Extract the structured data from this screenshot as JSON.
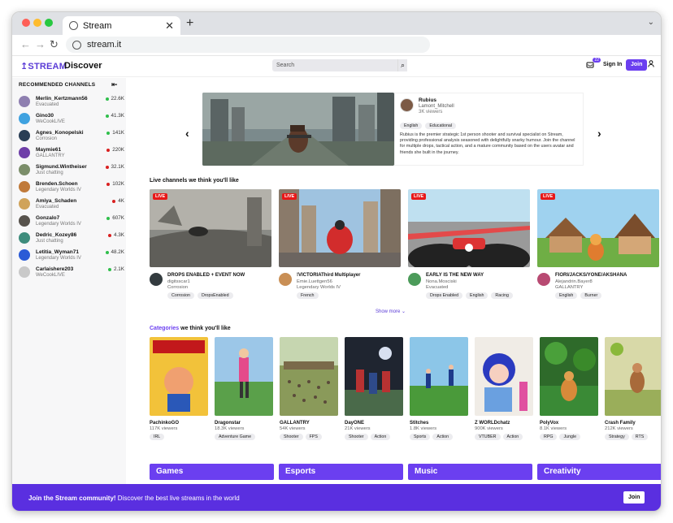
{
  "browser": {
    "tab_title": "Stream",
    "url": "stream.it"
  },
  "header": {
    "logo": "STREAM",
    "page_title": "Discover",
    "search_placeholder": "Search",
    "notif_count": "22",
    "signin_label": "Sign In",
    "join_label": "Join"
  },
  "sidebar": {
    "title": "RECOMMENDED CHANNELS",
    "channels": [
      {
        "name": "Merlin_Kertzmann56",
        "game": "Evacuated",
        "viewers": "22.6K",
        "status": "#2fbf4b",
        "avatar": "#8e7fb0"
      },
      {
        "name": "Gino30",
        "game": "WeCookLIVE",
        "viewers": "41.3K",
        "status": "#2fbf4b",
        "avatar": "#3fa2e0"
      },
      {
        "name": "Agnes_Konopelski",
        "game": "Corrosion",
        "viewers": "141K",
        "status": "#2fbf4b",
        "avatar": "#2a3e55"
      },
      {
        "name": "Maymie61",
        "game": "GALLANTRY",
        "viewers": "220K",
        "status": "#d92020",
        "avatar": "#6e3fa8"
      },
      {
        "name": "Sigmund.Wintheiser",
        "game": "Just chatting",
        "viewers": "32.1K",
        "status": "#d92020",
        "avatar": "#7b8e6a"
      },
      {
        "name": "Brenden.Schoen",
        "game": "Legendary Worlds IV",
        "viewers": "102K",
        "status": "#d92020",
        "avatar": "#c07a3a"
      },
      {
        "name": "Amiya_Schaden",
        "game": "Evacuated",
        "viewers": "4K",
        "status": "#d92020",
        "avatar": "#d0a35a"
      },
      {
        "name": "Gonzalo7",
        "game": "Legendary Worlds IV",
        "viewers": "607K",
        "status": "#2fbf4b",
        "avatar": "#57524c"
      },
      {
        "name": "Dedric_Kozey86",
        "game": "Just chatting",
        "viewers": "4.3K",
        "status": "#d92020",
        "avatar": "#3e8c7c"
      },
      {
        "name": "Letitia_Wyman71",
        "game": "Legendary Worlds IV",
        "viewers": "48.2K",
        "status": "#2fbf4b",
        "avatar": "#2b5bd6"
      },
      {
        "name": "Carlaishere203",
        "game": "WeCookLIVE",
        "viewers": "2.1K",
        "status": "#2fbf4b",
        "avatar": "#c9c9c9"
      }
    ]
  },
  "featured": {
    "name": "Rubius",
    "user": "Lamont_Mitchell",
    "viewers": "3K viewers",
    "tags": [
      "English",
      "Educational"
    ],
    "description": "Rubius is the premier strategic 1st person shooter and survival specialist on Stream, providing professional analysis seasoned with delightfully snarky humour. Join the channel for multiple drops, tactical action, and a mature community based on the users avatar and friends she built in the journey."
  },
  "live_section": {
    "title": "Live channels we think you'll like",
    "live_badge": "LIVE",
    "show_more": "Show more",
    "channels": [
      {
        "title": "DROPS ENABLED + EVENT NOW",
        "user": "digitsscar1",
        "game": "Corrosion",
        "tags": [
          "Corrosion",
          "DropsEnabled"
        ],
        "avatar": "#333b3f"
      },
      {
        "title": "!VICTORIAThird Multiplayer",
        "user": "Emie.Luettgen56",
        "game": "Legendary Worlds IV",
        "tags": [
          "French"
        ],
        "avatar": "#c98f55"
      },
      {
        "title": "EARLY IS THE NEW WAY",
        "user": "Nona.Mosciski",
        "game": "Evacuated",
        "tags": [
          "Drops Enabled",
          "English",
          "Racing"
        ],
        "avatar": "#4c9b5a"
      },
      {
        "title": "FIORI/JACKS/YONE/AKSHANA",
        "user": "Alejandrin.Bayer8",
        "game": "GALLANTRY",
        "tags": [
          "English",
          "Burner"
        ],
        "avatar": "#b84a72"
      }
    ]
  },
  "categories_section": {
    "title_accent": "Categories",
    "title_rest": " we think you'll like",
    "items": [
      {
        "name": "PachinkoGO",
        "viewers": "117K viewers",
        "tags": [
          "IRL"
        ]
      },
      {
        "name": "Dragonstar",
        "viewers": "18.3K viewers",
        "tags": [
          "Adventure Game"
        ]
      },
      {
        "name": "GALLANTRY",
        "viewers": "54K viewers",
        "tags": [
          "Shooter",
          "FPS"
        ]
      },
      {
        "name": "DayONE",
        "viewers": "21K viewers",
        "tags": [
          "Shooter",
          "Action"
        ]
      },
      {
        "name": "Stitches",
        "viewers": "1.8K viewers",
        "tags": [
          "Sports",
          "Action"
        ]
      },
      {
        "name": "Z WORLDchatz",
        "viewers": "900K viewers",
        "tags": [
          "VTUBER",
          "Action"
        ]
      },
      {
        "name": "PolyVox",
        "viewers": "8.1K viewers",
        "tags": [
          "RPG",
          "Jungle"
        ]
      },
      {
        "name": "Crash Family",
        "viewers": "212K viewers",
        "tags": [
          "Strategy",
          "RTS"
        ]
      }
    ]
  },
  "big_categories": [
    "Games",
    "Esports",
    "Music",
    "Creativity"
  ],
  "footer": {
    "text_bold": "Join the Stream community!",
    "text_rest": " Discover the best live streams in the world",
    "join_label": "Join"
  },
  "colors": {
    "accent": "#6b3ff0",
    "live": "#e81818",
    "online": "#2fbf4b",
    "offline": "#d92020"
  }
}
